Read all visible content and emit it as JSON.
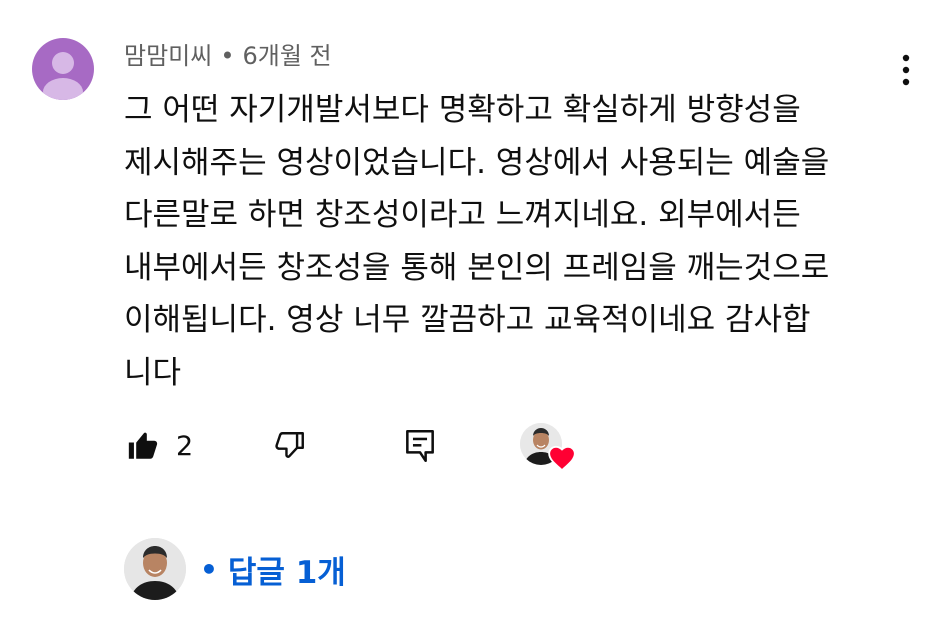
{
  "comment": {
    "author": "맘맘미씨",
    "separator": "•",
    "time": "6개월 전",
    "lines": [
      "그 어떤 자기개발서보다 명확하고 확실하게 방향성을",
      "제시해주는 영상이었습니다. 영상에서 사용되는 예술을",
      "다른말로 하면 창조성이라고 느껴지네요. 외부에서든",
      "내부에서든 창조성을 통해 본인의 프레임을 깨는것으로",
      "이해됩니다. 영상 너무 깔끔하고 교육적이네요 감사합",
      "니다"
    ]
  },
  "actions": {
    "like_count": "2",
    "like_icon": "thumbs-up-filled-icon",
    "dislike_icon": "thumbs-down-icon",
    "reply_icon": "reply-comment-icon",
    "creator_heart_icon": "heart-icon"
  },
  "replies": {
    "separator": "•",
    "label": "답글 1개",
    "color": "#065fd4"
  },
  "colors": {
    "commenter_avatar_bg": "#a76ac4",
    "heart": "#ff0033",
    "meta_text": "#606060"
  }
}
